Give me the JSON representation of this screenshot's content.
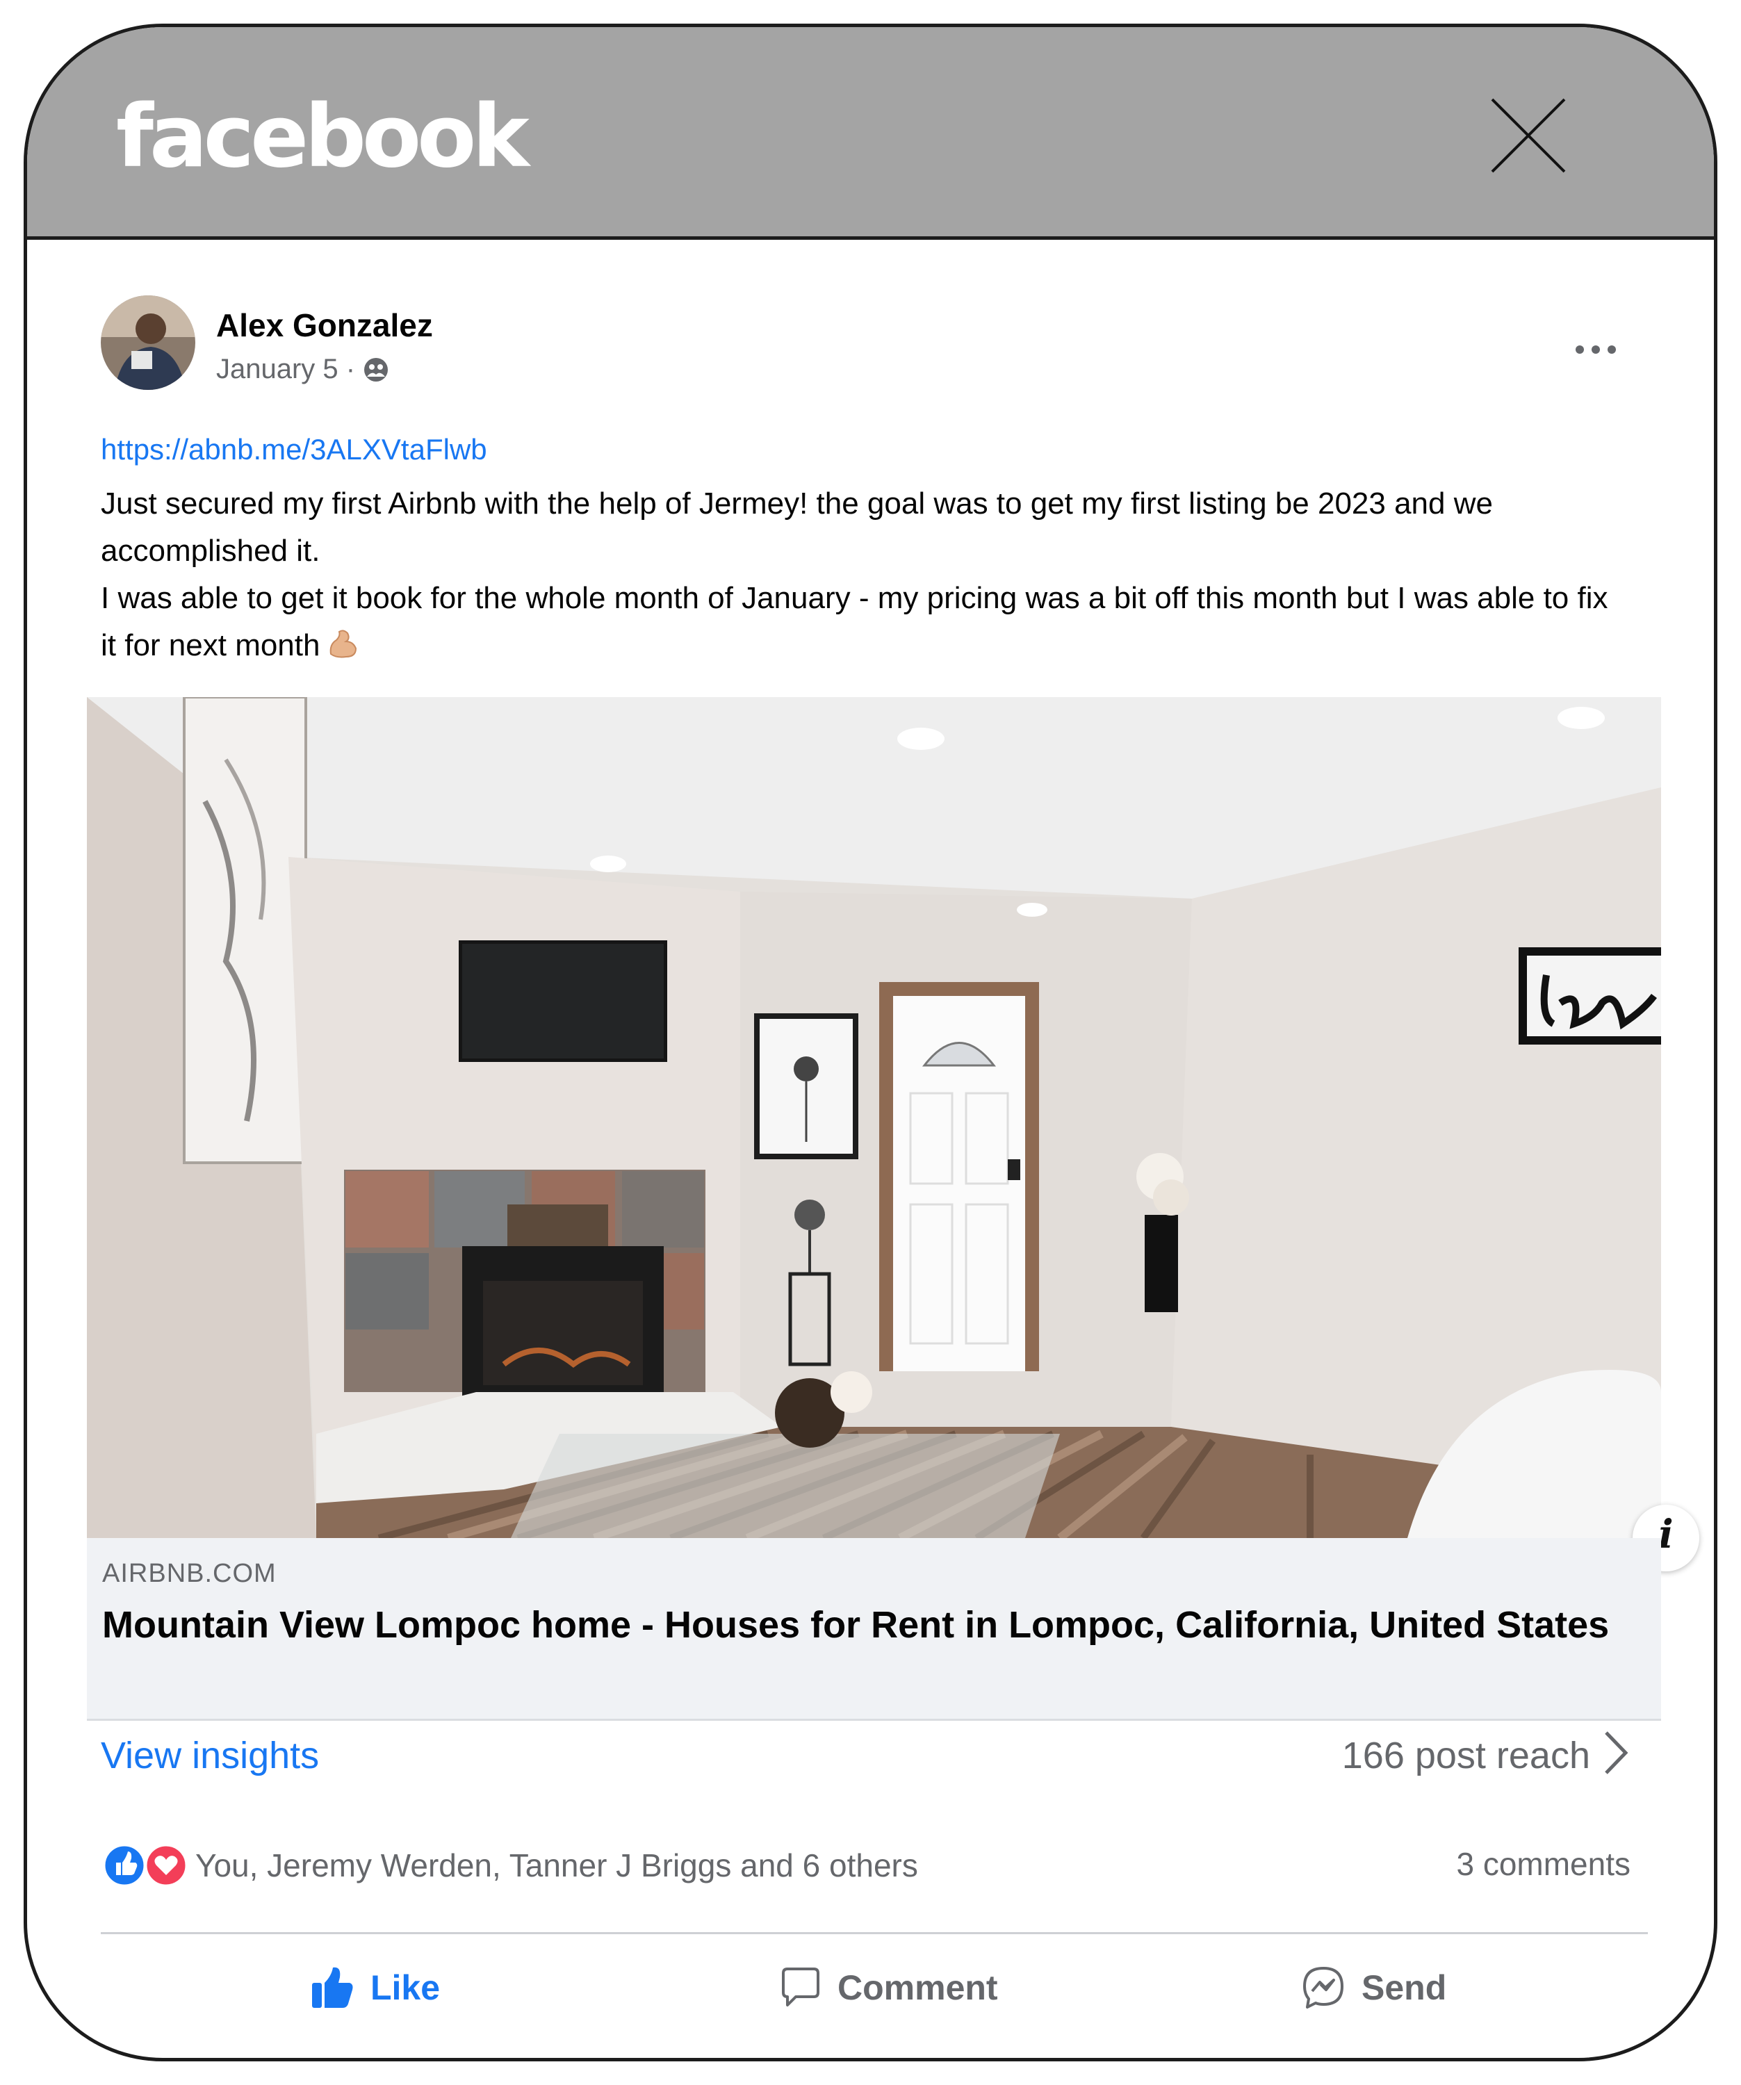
{
  "header": {
    "brand": "facebook",
    "close_icon": "close-icon"
  },
  "post": {
    "author": "Alex Gonzalez",
    "date": "January 5 ·",
    "audience_icon": "friends-icon",
    "link": "https://abnb.me/3ALXVtaFlwb",
    "paragraph1": "Just secured my first Airbnb with the help of Jermey! the goal was to get my first listing be 2023 and we accomplished it.",
    "paragraph2": "I was able to get it book for the whole month of January - my pricing was a bit off this month but I was able to fix it for next month",
    "emoji": "flexed-biceps-emoji"
  },
  "link_card": {
    "domain": "AIRBNB.COM",
    "title": "Mountain View Lompoc home - Houses for Rent in Lompoc, California, United States",
    "info_label": "i"
  },
  "insights": {
    "label": "View insights",
    "reach": "166 post reach"
  },
  "engagement": {
    "reactors": "You, Jeremy Werden, Tanner J Briggs and 6 others",
    "comments": "3 comments"
  },
  "actions": {
    "like": "Like",
    "comment": "Comment",
    "send": "Send"
  },
  "colors": {
    "accent": "#1877f2",
    "header_bg": "#a4a4a4",
    "love": "#f33e58",
    "muted": "#65676b"
  }
}
